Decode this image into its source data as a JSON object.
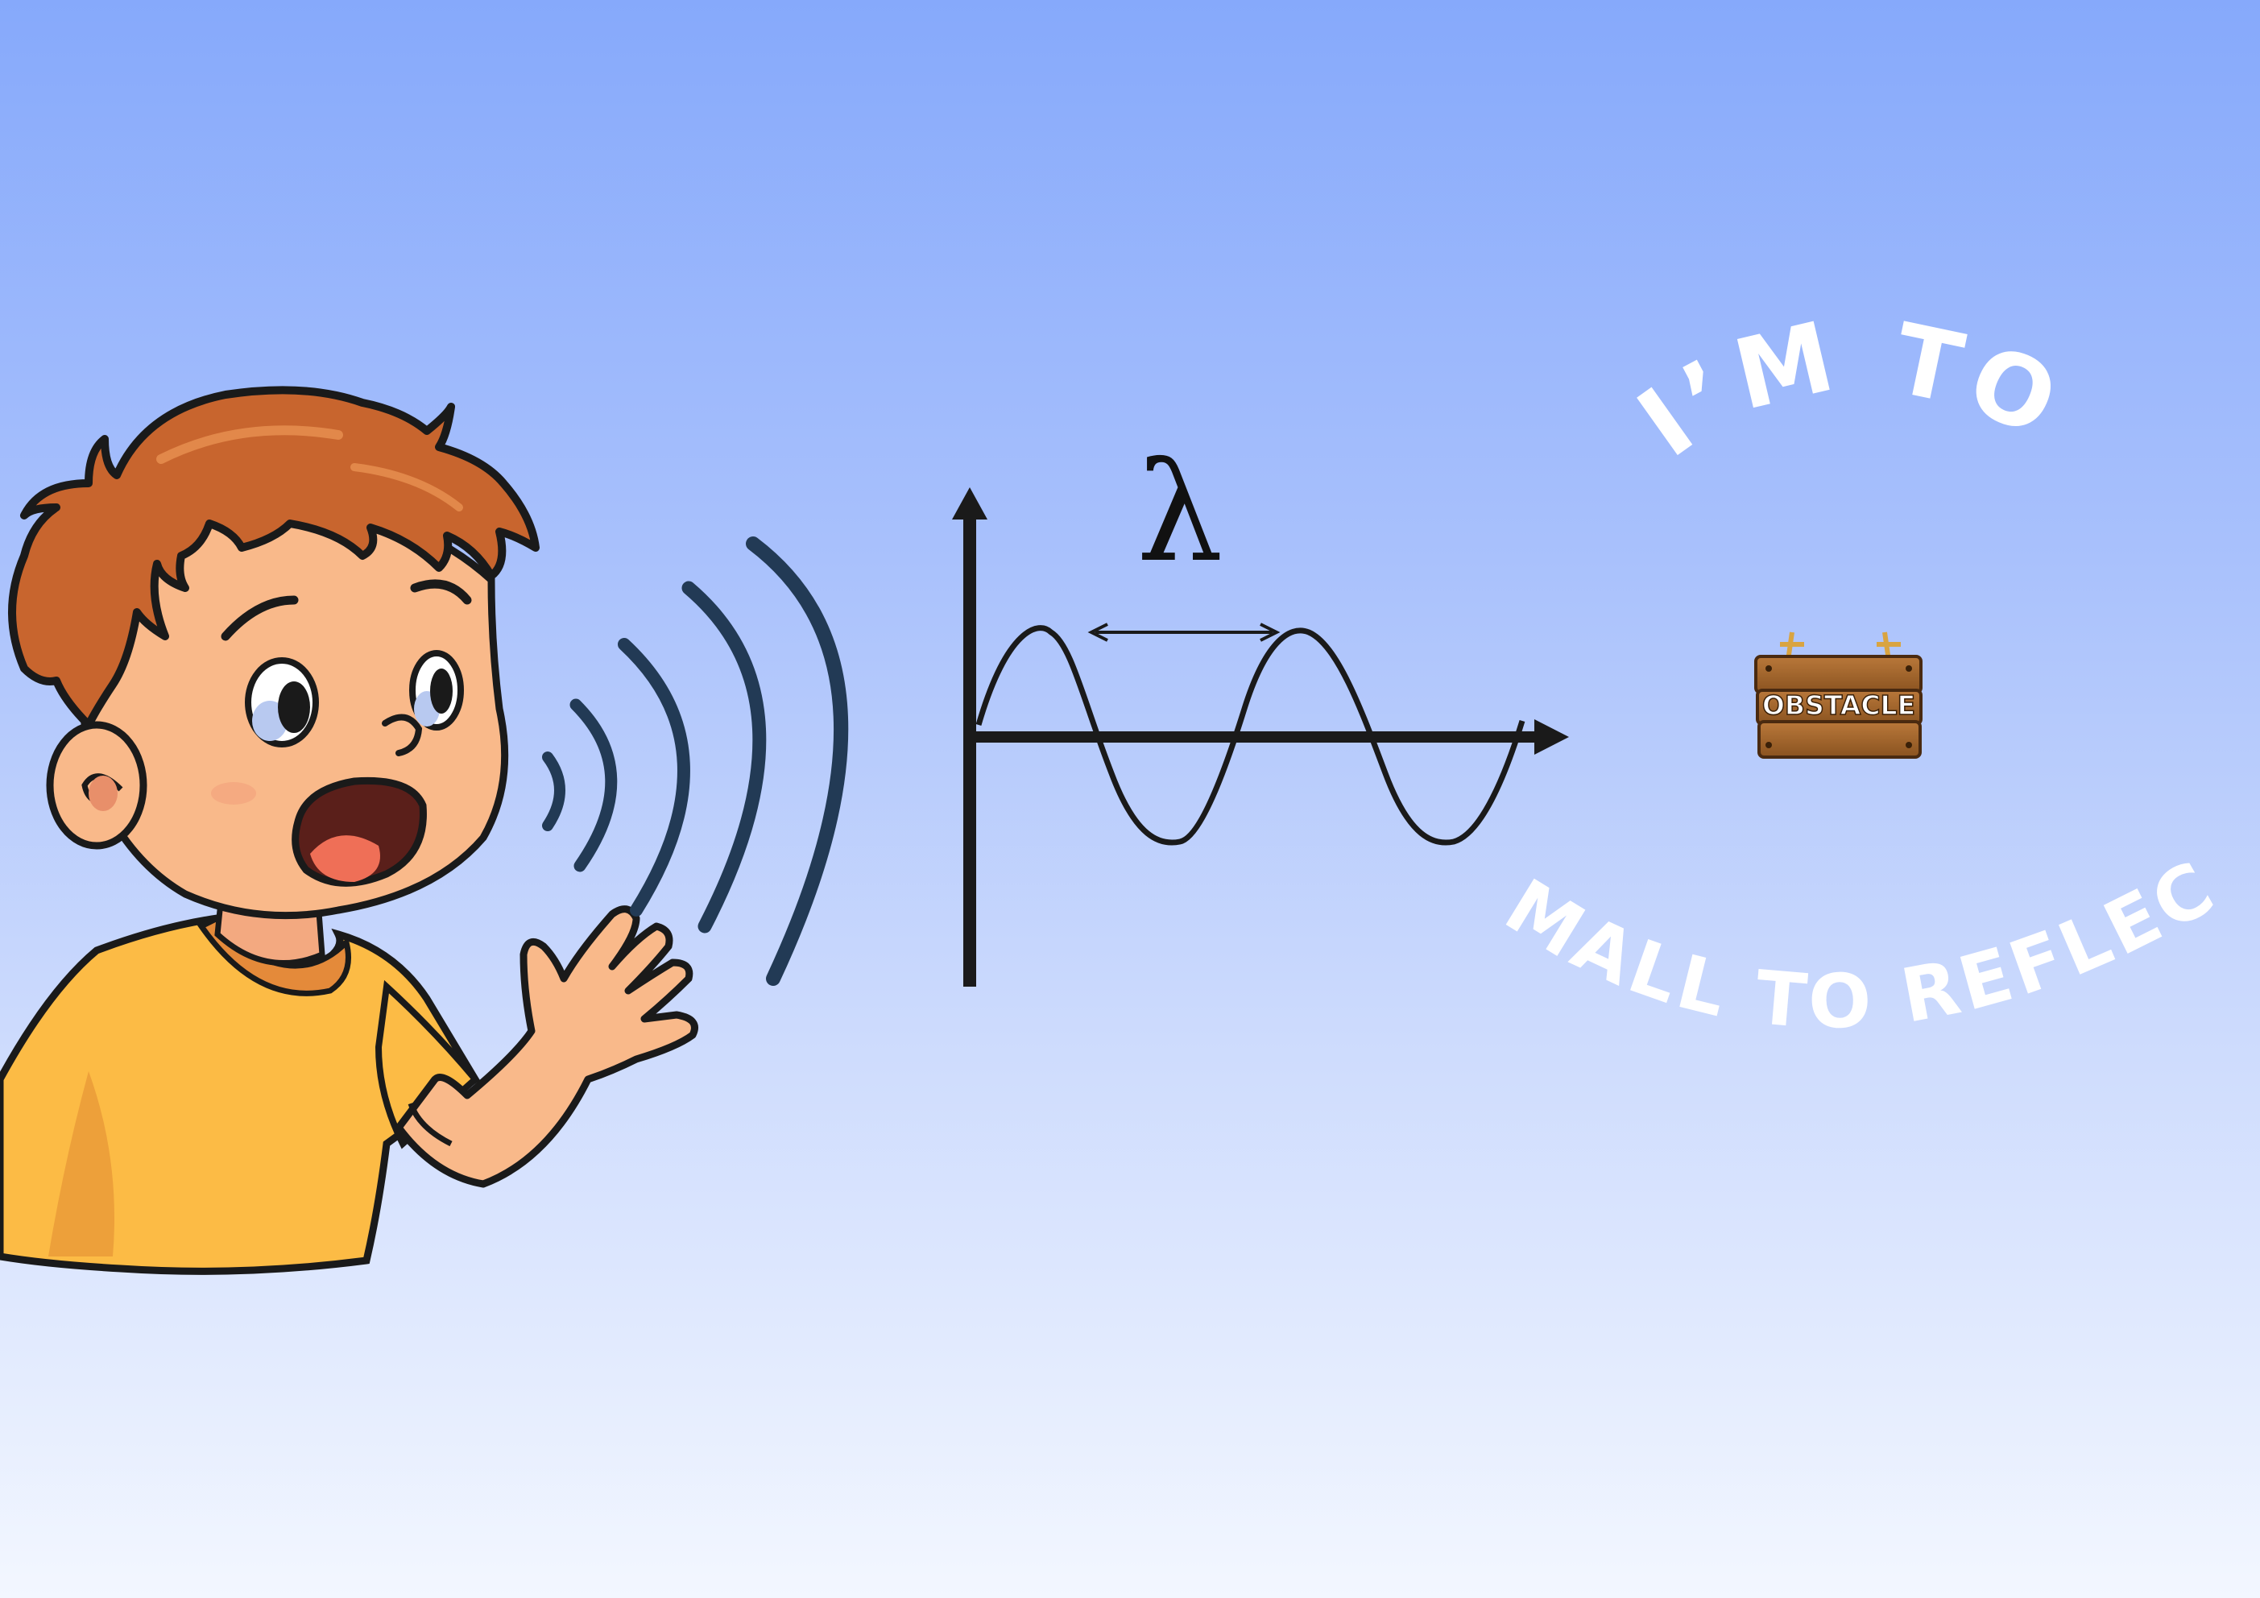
{
  "diagram": {
    "wave": {
      "symbol": "λ"
    },
    "slogan": {
      "top": "I’M TO",
      "bottom": "SMALL TO REFLECT"
    },
    "obstacle_sign": {
      "label": "OBSTACLE"
    }
  },
  "colors": {
    "background_top": "#86a9fb",
    "background_bottom": "#f3f7ff",
    "sound_waves": "#223a55",
    "wave_line": "#111111",
    "slogan_text": "#ffffff",
    "hair": "#c8652e",
    "skin": "#f9b98a",
    "shirt": "#fcbb45",
    "mouth": "#5a1f1a",
    "tongue": "#ef6f57",
    "wood": "#9a5e24"
  }
}
